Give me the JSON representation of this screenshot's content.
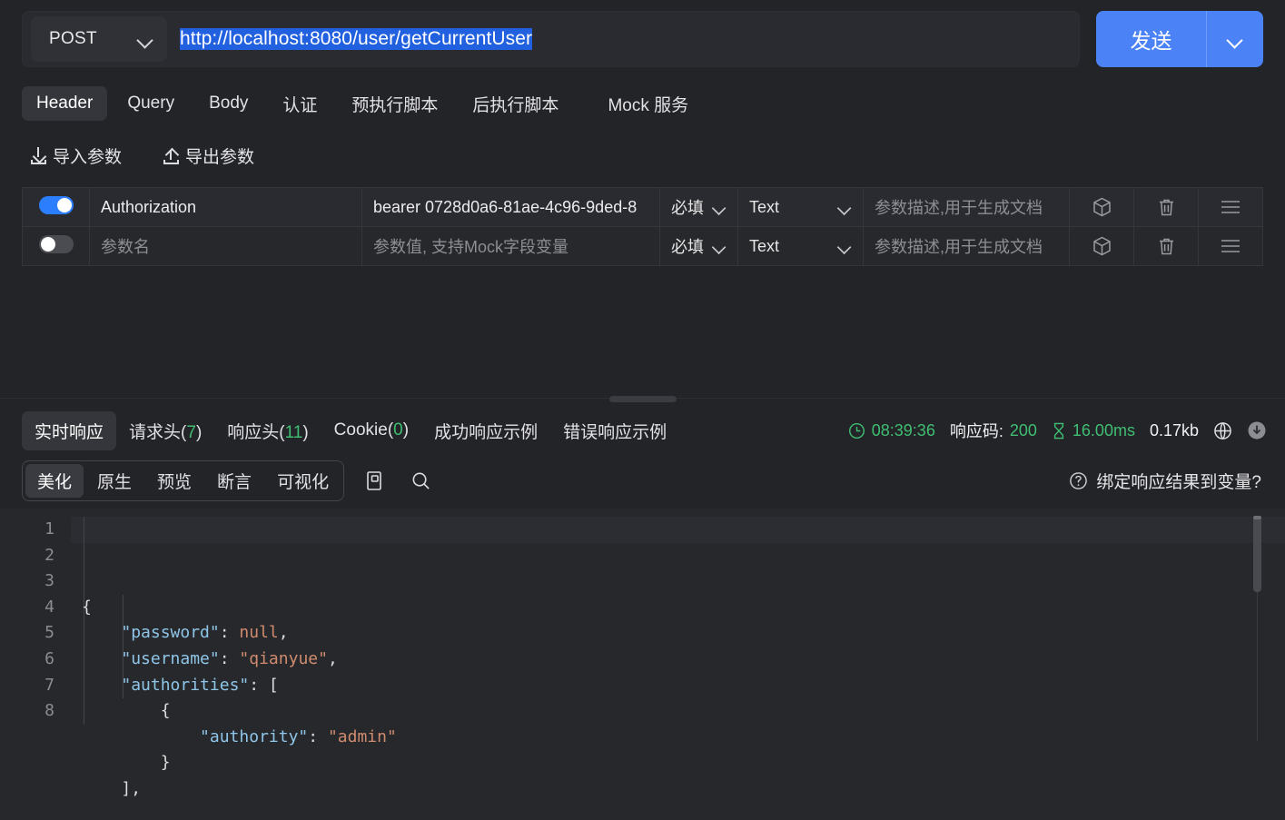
{
  "request": {
    "method": "POST",
    "url": "http://localhost:8080/user/getCurrentUser",
    "send_label": "发送"
  },
  "request_tabs": [
    {
      "label": "Header",
      "active": true
    },
    {
      "label": "Query",
      "active": false
    },
    {
      "label": "Body",
      "active": false
    },
    {
      "label": "认证",
      "active": false
    },
    {
      "label": "预执行脚本",
      "active": false
    },
    {
      "label": "后执行脚本",
      "active": false
    },
    {
      "label": "Mock 服务",
      "active": false
    }
  ],
  "io": {
    "import_label": "导入参数",
    "export_label": "导出参数"
  },
  "param_table": {
    "placeholders": {
      "name": "参数名",
      "value": "参数值, 支持Mock字段变量",
      "desc": "参数描述,用于生成文档"
    },
    "rows": [
      {
        "enabled": true,
        "name": "Authorization",
        "value": "bearer 0728d0a6-81ae-4c96-9ded-8",
        "required": "必填",
        "type": "Text",
        "desc": ""
      },
      {
        "enabled": false,
        "name": "",
        "value": "",
        "required": "必填",
        "type": "Text",
        "desc": ""
      }
    ]
  },
  "response_tabs": [
    {
      "label": "实时响应",
      "count": null,
      "active": true
    },
    {
      "label": "请求头",
      "count": "7",
      "active": false
    },
    {
      "label": "响应头",
      "count": "11",
      "active": false
    },
    {
      "label": "Cookie",
      "count": "0",
      "active": false
    },
    {
      "label": "成功响应示例",
      "count": null,
      "active": false
    },
    {
      "label": "错误响应示例",
      "count": null,
      "active": false
    }
  ],
  "response_meta": {
    "time": "08:39:36",
    "status_label": "响应码:",
    "status_code": "200",
    "duration": "16.00ms",
    "size": "0.17kb"
  },
  "viewer": {
    "modes": [
      {
        "label": "美化",
        "active": true
      },
      {
        "label": "原生",
        "active": false
      },
      {
        "label": "预览",
        "active": false
      },
      {
        "label": "断言",
        "active": false
      },
      {
        "label": "可视化",
        "active": false
      }
    ],
    "bind_label": "绑定响应结果到变量?"
  },
  "code": {
    "lines": [
      {
        "n": "1",
        "segments": [
          {
            "t": "{",
            "c": "p"
          }
        ],
        "indent": 0
      },
      {
        "n": "2",
        "segments": [
          {
            "t": "\"password\"",
            "c": "k"
          },
          {
            "t": ": ",
            "c": "p"
          },
          {
            "t": "null",
            "c": "v"
          },
          {
            "t": ",",
            "c": "p"
          }
        ],
        "indent": 1
      },
      {
        "n": "3",
        "segments": [
          {
            "t": "\"username\"",
            "c": "k"
          },
          {
            "t": ": ",
            "c": "p"
          },
          {
            "t": "\"qianyue\"",
            "c": "v"
          },
          {
            "t": ",",
            "c": "p"
          }
        ],
        "indent": 1
      },
      {
        "n": "4",
        "segments": [
          {
            "t": "\"authorities\"",
            "c": "k"
          },
          {
            "t": ": [",
            "c": "p"
          }
        ],
        "indent": 1
      },
      {
        "n": "5",
        "segments": [
          {
            "t": "{",
            "c": "p"
          }
        ],
        "indent": 2
      },
      {
        "n": "6",
        "segments": [
          {
            "t": "\"authority\"",
            "c": "k"
          },
          {
            "t": ": ",
            "c": "p"
          },
          {
            "t": "\"admin\"",
            "c": "v"
          }
        ],
        "indent": 3
      },
      {
        "n": "7",
        "segments": [
          {
            "t": "}",
            "c": "p"
          }
        ],
        "indent": 2
      },
      {
        "n": "8",
        "segments": [
          {
            "t": "],",
            "c": "p"
          }
        ],
        "indent": 1
      }
    ]
  },
  "colors": {
    "accent": "#4b83f7",
    "toggle_on": "#2b7fff",
    "success": "#3fbe72",
    "selection": "#2160df",
    "bg": "#232428",
    "json_key": "#8fc6e8",
    "json_value": "#d08b6e"
  }
}
